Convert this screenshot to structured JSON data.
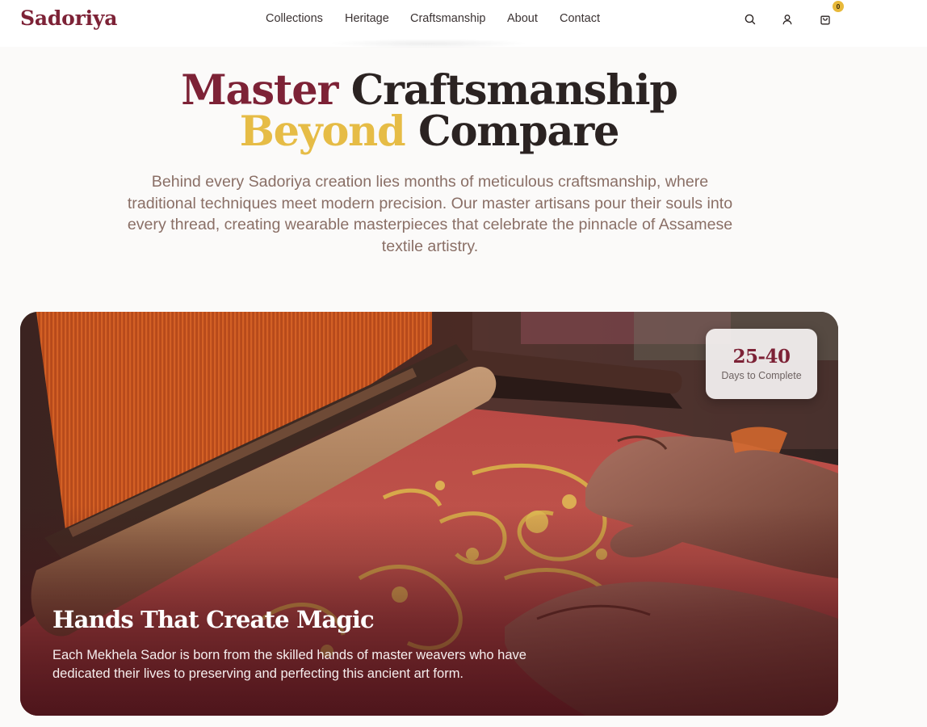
{
  "brand": {
    "name": "Sadoriya",
    "color": "#7d2236"
  },
  "nav": {
    "items": [
      {
        "label": "Collections"
      },
      {
        "label": "Heritage"
      },
      {
        "label": "Craftsmanship"
      },
      {
        "label": "About"
      },
      {
        "label": "Contact"
      }
    ]
  },
  "header_icons": {
    "search": "search-icon",
    "account": "user-icon",
    "cart": "shopping-bag-icon",
    "cart_count": "0"
  },
  "hero": {
    "title_line1_accent": "Master",
    "title_line1_rest": " Craftsmanship",
    "title_line2_accent": "Beyond",
    "title_line2_rest": " Compare",
    "description": "Behind every Sadoriya creation lies months of meticulous craftsmanship, where traditional techniques meet modern precision. Our master artisans pour their souls into every thread, creating wearable masterpieces that celebrate the pinnacle of Assamese textile artistry."
  },
  "feature_card": {
    "badge_value": "25-40",
    "badge_label": "Days to Complete",
    "heading": "Hands That Create Magic",
    "text": "Each Mekhela Sador is born from the skilled hands of master weavers who have dedicated their lives to preserving and perfecting this ancient art form."
  },
  "colors": {
    "accent_red": "#7d2236",
    "accent_gold": "#e6bc46",
    "body_text": "#8a6f66",
    "background": "#fbfaf9"
  }
}
